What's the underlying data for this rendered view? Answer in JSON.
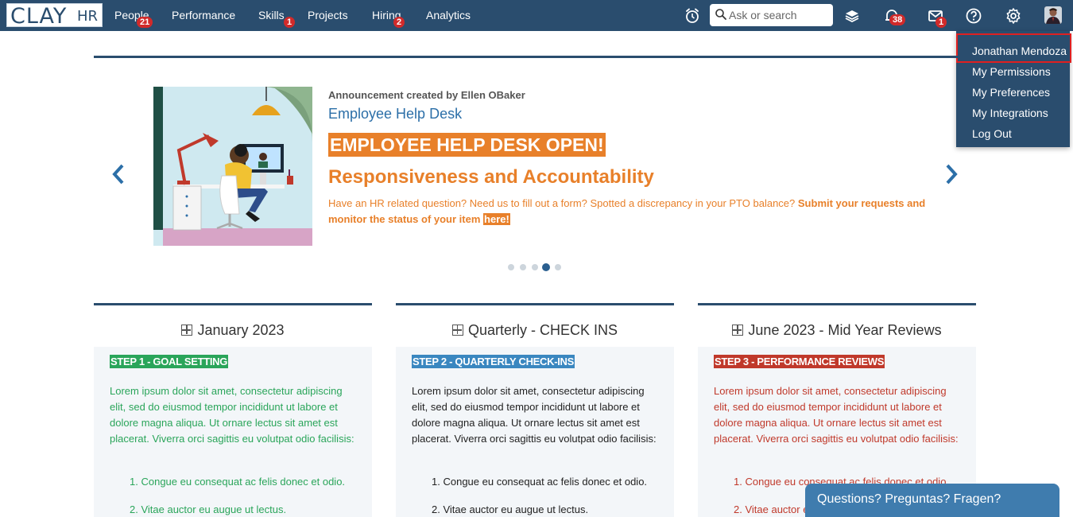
{
  "app": {
    "logo_main": "CLAY",
    "logo_sub": "HR"
  },
  "nav": {
    "items": [
      {
        "label": "People",
        "badge": "21"
      },
      {
        "label": "Performance",
        "badge": ""
      },
      {
        "label": "Skills",
        "badge": "1"
      },
      {
        "label": "Projects",
        "badge": ""
      },
      {
        "label": "Hiring",
        "badge": "2"
      },
      {
        "label": "Analytics",
        "badge": ""
      }
    ]
  },
  "search": {
    "placeholder": "Ask or search"
  },
  "toolbar": {
    "notifications_badge": "38",
    "messages_badge": "1"
  },
  "user_menu": {
    "name": "Jonathan Mendoza",
    "items": [
      "My Permissions",
      "My Preferences",
      "My Integrations",
      "Log Out"
    ]
  },
  "announcement": {
    "created_by": "Announcement created by Ellen OBaker",
    "title": "Employee Help Desk",
    "banner": "EMPLOYEE HELP DESK OPEN!",
    "subtitle": "Responsiveness and Accountability",
    "body_plain": "Have an HR related question? Need us to fill out a form? Spotted a discrepancy in your PTO balance?",
    "body_bold": "Submit your requests and monitor the status of your item",
    "link": "here!",
    "dot_count": 5,
    "active_dot": 4
  },
  "cards": [
    {
      "title": "January 2023",
      "step": "STEP 1 - GOAL SETTING",
      "step_color": "#2aa55a",
      "text_color": "#2aa55a",
      "paragraph": "Lorem ipsum dolor sit amet, consectetur adipiscing elit, sed do eiusmod tempor incididunt ut labore et dolore magna aliqua. Ut ornare lectus sit amet est placerat. Viverra orci sagittis eu volutpat odio facilisis:",
      "list": [
        "Congue eu consequat ac felis donec et odio.",
        "Vitae auctor eu augue ut lectus."
      ]
    },
    {
      "title": "Quarterly - CHECK INS",
      "step": "STEP 2 - QUARTERLY CHECK-INS",
      "step_color": "#3a87c0",
      "text_color": "#222222",
      "paragraph": "Lorem ipsum dolor sit amet, consectetur adipiscing elit, sed do eiusmod tempor incididunt ut labore et dolore magna aliqua. Ut ornare lectus sit amet est placerat. Viverra orci sagittis eu volutpat odio facilisis:",
      "list": [
        "Congue eu consequat ac felis donec et odio.",
        "Vitae auctor eu augue ut lectus."
      ]
    },
    {
      "title": "June 2023 - Mid Year Reviews",
      "step": "STEP 3 - PERFORMANCE REVIEWS",
      "step_color": "#c0392b",
      "text_color": "#c0392b",
      "paragraph": "Lorem ipsum dolor sit amet, consectetur adipiscing elit, sed do eiusmod tempor incididunt ut labore et dolore magna aliqua. Ut ornare lectus sit amet est placerat. Viverra orci sagittis eu volutpat odio facilisis:",
      "list": [
        "Congue eu consequat ac felis donec et odio.",
        "Vitae auctor eu augue ut lectus."
      ]
    }
  ],
  "chat": {
    "label": "Questions? Preguntas? Fragen?"
  },
  "colors": {
    "nav_bg": "#2a4d6e",
    "accent_orange": "#e8802a",
    "link_blue": "#2c6fa8"
  }
}
